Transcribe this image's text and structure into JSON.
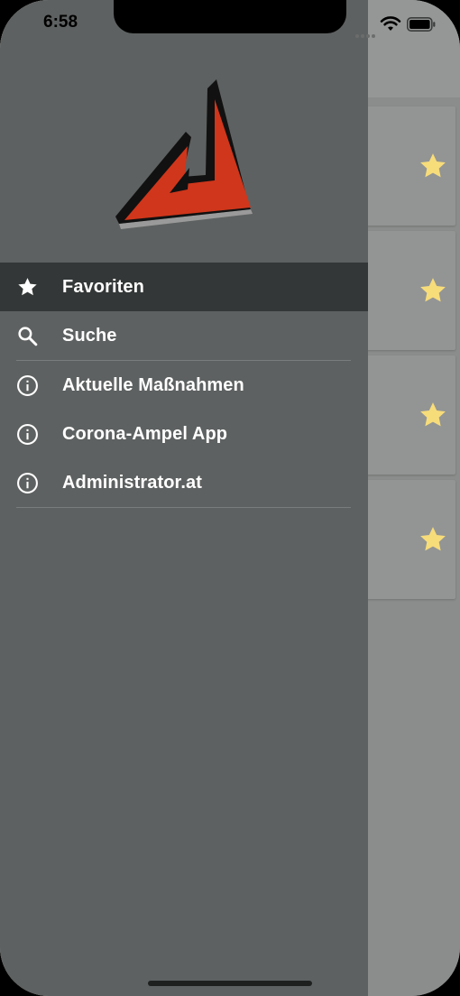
{
  "status_bar": {
    "time": "6:58"
  },
  "drawer": {
    "menu": [
      {
        "label": "Favoriten",
        "icon": "star-icon",
        "active": true
      },
      {
        "label": "Suche",
        "icon": "search-icon",
        "active": false
      },
      {
        "label": "Aktuelle Maßnahmen",
        "icon": "info-icon",
        "active": false
      },
      {
        "label": "Corona-Ampel App",
        "icon": "info-icon",
        "active": false
      },
      {
        "label": "Administrator.at",
        "icon": "info-icon",
        "active": false
      }
    ]
  },
  "background_list": {
    "favorite_star_color": "#f7dc7a",
    "card_count": 4
  },
  "colors": {
    "drawer": "#5e6161",
    "active_item": "#343737",
    "logo_red": "#d0361b"
  }
}
